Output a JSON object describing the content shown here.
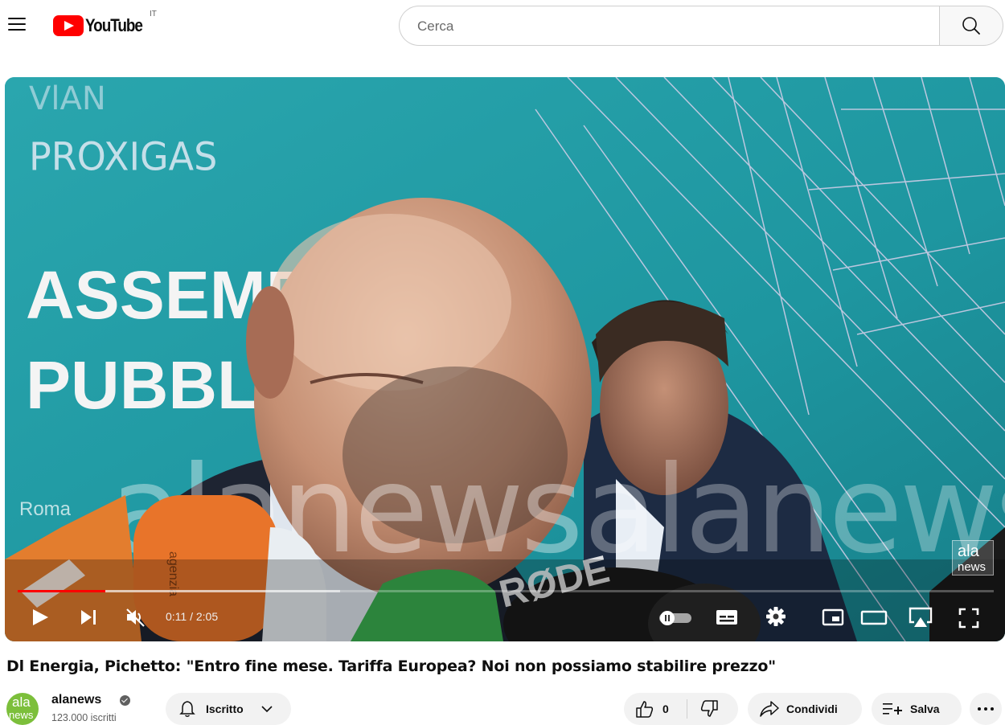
{
  "header": {
    "logo_text": "YouTube",
    "region_code": "IT",
    "search_placeholder": "Cerca"
  },
  "player": {
    "time": "0:11 / 2:05",
    "progress_played_fraction": 0.09,
    "progress_buffered_fraction": 0.33,
    "muted": true,
    "overlay_texts": {
      "sponsor": "PROXIGAS",
      "banner_line1": "ASSEMBL",
      "banner_line2": "PUBBL",
      "watermark_large": "alanews",
      "watermark_badge_top": "ala",
      "watermark_badge_bottom": "news",
      "location_label": "Roma",
      "mic_label_1": "agenzia",
      "mic_label_2": "RØDE"
    },
    "colors": {
      "backdrop": "#1e9aa3",
      "progress_played": "#ff0000"
    }
  },
  "video": {
    "title": "Dl Energia, Pichetto: \"Entro fine mese. Tariffa Europea? Noi non possiamo stabilire prezzo\""
  },
  "channel": {
    "name": "alanews",
    "subscribers": "123.000 iscritti",
    "avatar_text_top": "ala",
    "avatar_text_bottom": "news",
    "avatar_color": "#7cbf3b",
    "subscribe_label": "Iscritto"
  },
  "actions": {
    "like_count": "0",
    "share_label": "Condividi",
    "save_label": "Salva"
  }
}
